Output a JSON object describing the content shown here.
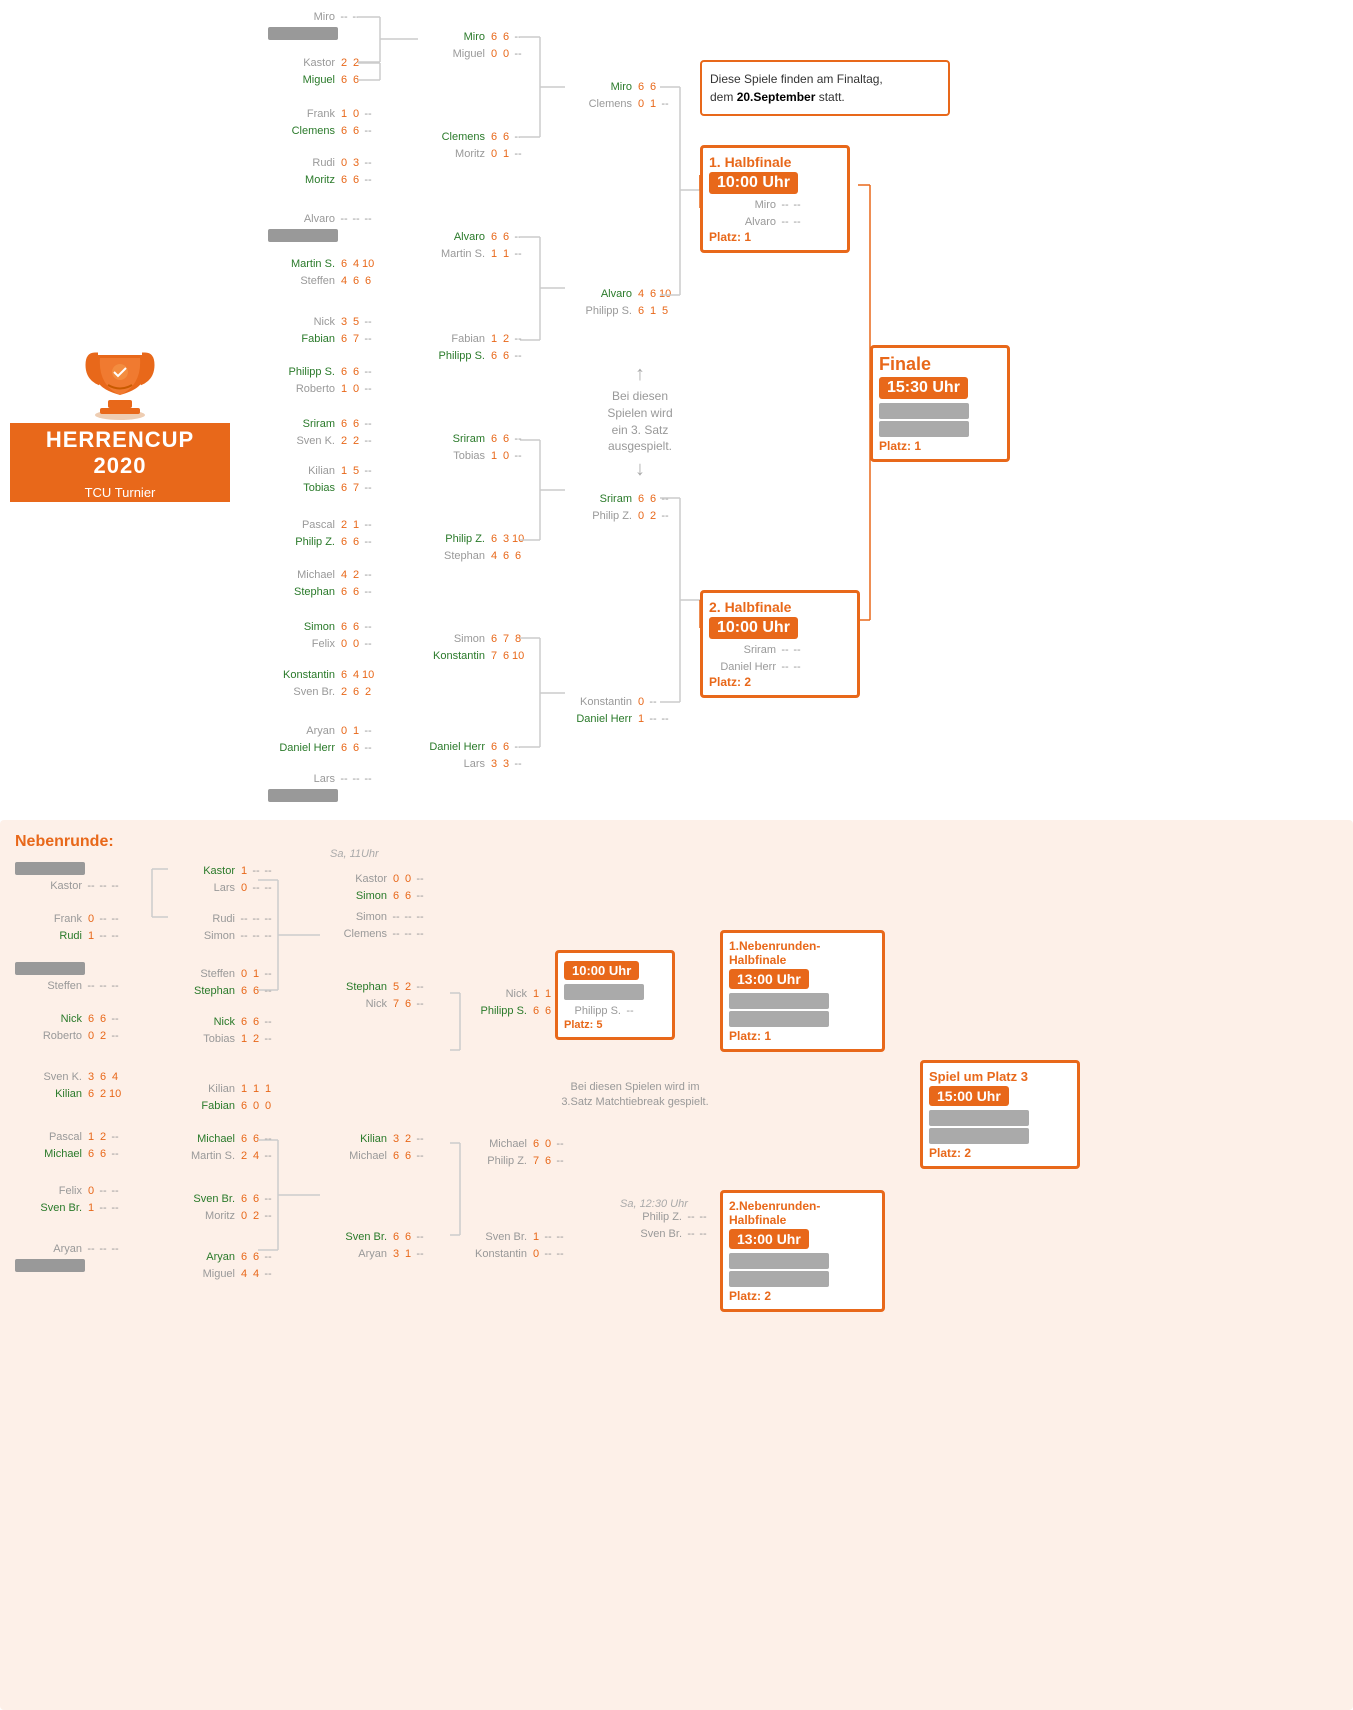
{
  "title": "HERRENCUP 2020 TCU Turnier",
  "logo": {
    "line1": "HERRENCUP 2020",
    "line2": "TCU Turnier"
  },
  "info_box": {
    "text": "Diese Spiele finden am Finaltag,",
    "text2": "dem 20.September statt."
  },
  "halbfinale1": {
    "title": "1. Halbfinale",
    "time": "10:00 Uhr",
    "p1": "Miro",
    "p2": "Alvaro",
    "platz": "Platz: 1"
  },
  "halbfinale2": {
    "title": "2. Halbfinale",
    "time": "10:00 Uhr",
    "p1": "Sriram",
    "p2": "Daniel Herr",
    "platz": "Platz: 2"
  },
  "finale": {
    "title": "Finale",
    "time": "15:30 Uhr",
    "platz": "Platz: 1"
  },
  "bei_diesen": "Bei diesen\nSpielen wird\nein 3. Satz\nausgespielt.",
  "neben_label": "Nebenrunde:",
  "neben_hf1": {
    "title": "1.Nebenrunden-\nHalbfinale",
    "time": "13:00 Uhr",
    "platz": "Platz: 1"
  },
  "neben_hf2": {
    "title": "2.Nebenrunden-\nHalbfinale",
    "time": "13:00 Uhr",
    "platz": "Platz: 2"
  },
  "neben_10": {
    "time": "10:00 Uhr",
    "platz": "Platz: 5"
  },
  "neben_platz3": {
    "title": "Spiel um Platz 3",
    "time": "15:00 Uhr",
    "platz": "Platz: 2"
  },
  "neben_info": "Bei diesen Spielen wird im\n3.Satz Matchtiebreak gespielt.",
  "sa_11": "Sa, 11Uhr",
  "sa_1230": "Sa, 12:30 Uhr"
}
